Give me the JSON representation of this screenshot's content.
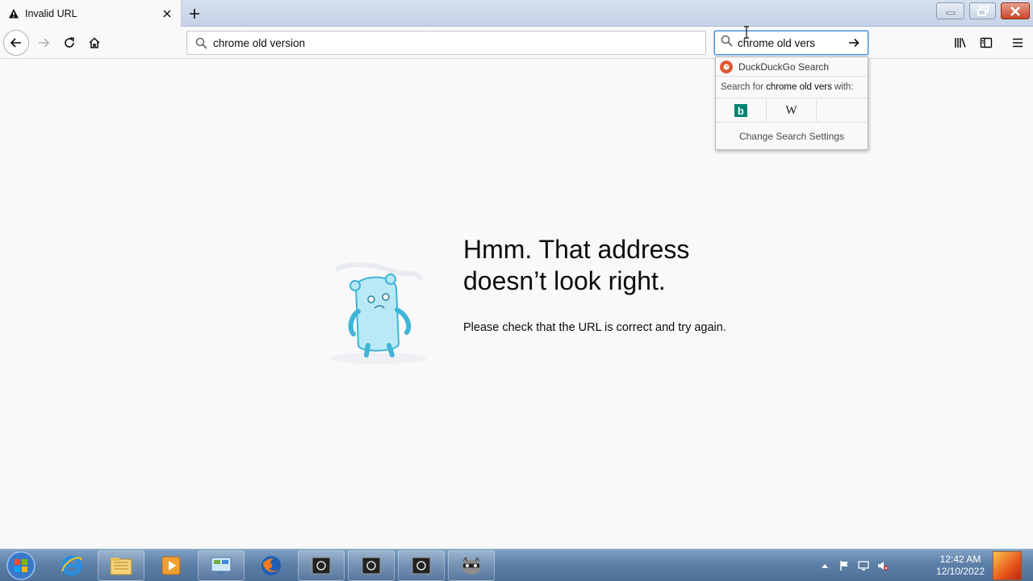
{
  "tab": {
    "title": "Invalid URL"
  },
  "urlbar": {
    "value": "chrome old version"
  },
  "searchbar": {
    "value": "chrome old vers"
  },
  "search_popup": {
    "engine_name": "DuckDuckGo Search",
    "search_for_prefix": "Search for",
    "search_for_query": "chrome old vers",
    "search_for_suffix": "with:",
    "engines": [
      "bing",
      "wikipedia",
      "empty"
    ],
    "wikipedia_glyph": "W",
    "bing_glyph": "b",
    "settings_label": "Change Search Settings"
  },
  "error": {
    "title_line1": "Hmm. That address",
    "title_line2": "doesn’t look right.",
    "description": "Please check that the URL is correct and try again."
  },
  "taskbar": {
    "apps": [
      "internet-explorer",
      "file-explorer",
      "media-player",
      "control-panel",
      "firefox",
      "app-1",
      "app-2",
      "app-3",
      "raccoon-app"
    ],
    "clock_time": "12:42 AM",
    "clock_date": "12/10/2022"
  },
  "colors": {
    "accent": "#4a90d9",
    "duckduckgo": "#de5833",
    "bing": "#008373",
    "gopher": "#9be0f3"
  }
}
